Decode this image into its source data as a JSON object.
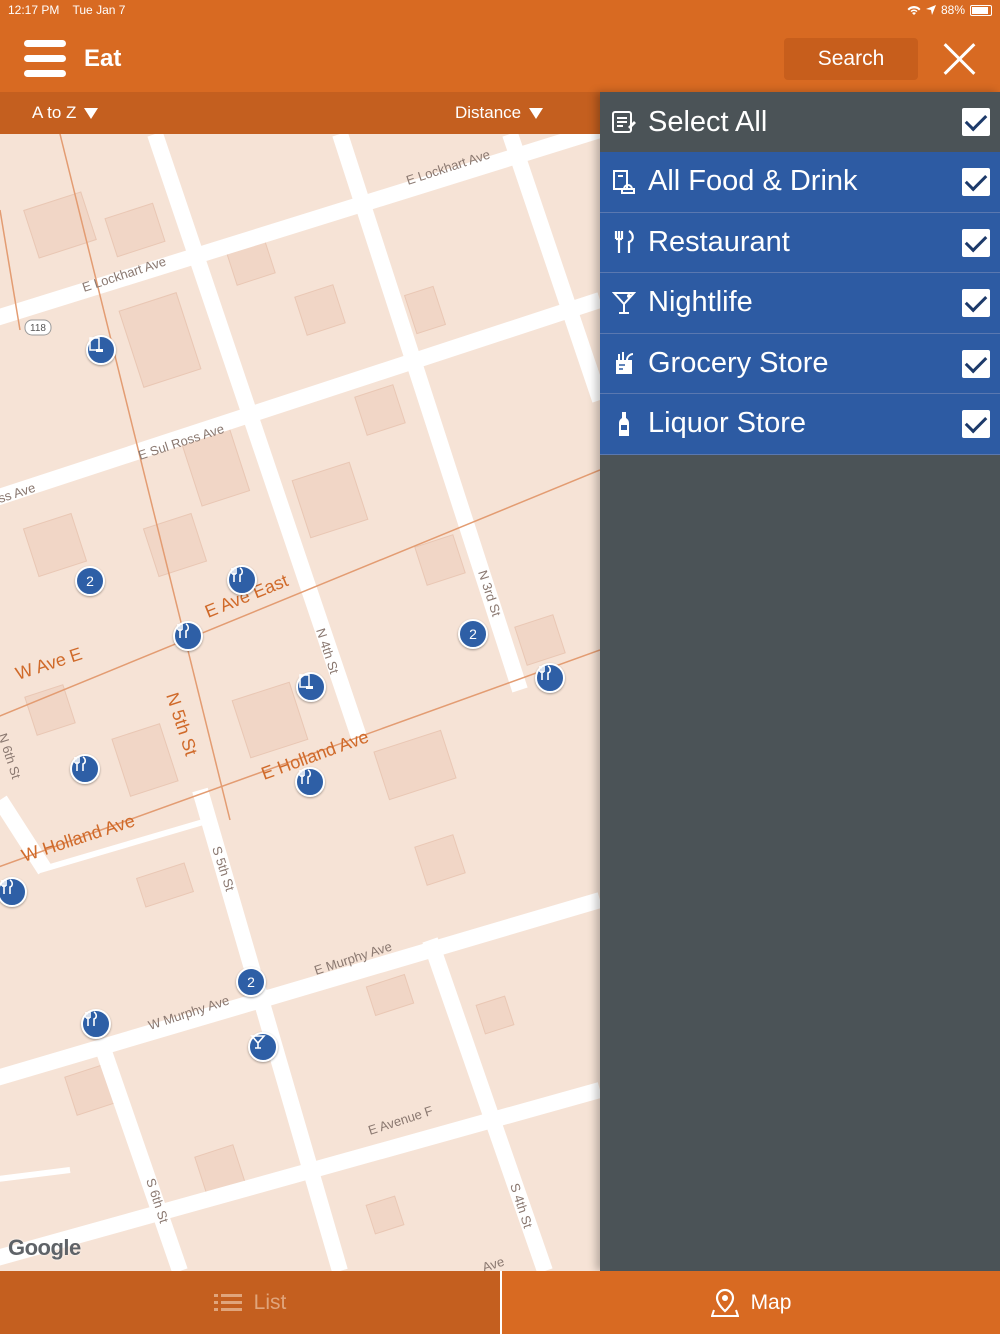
{
  "status": {
    "time": "12:17 PM",
    "date": "Tue Jan 7",
    "battery": "88%"
  },
  "header": {
    "title": "Eat",
    "search_label": "Search"
  },
  "sortbar": {
    "az_label": "A to Z",
    "distance_label": "Distance"
  },
  "map": {
    "streets": {
      "lockhart_1": "E Lockhart Ave",
      "lockhart_2": "E Lockhart Ave",
      "route": "118",
      "sul_ross": "E Sul Ross Ave",
      "ross": "ss Ave",
      "ave_e_east": "E Ave East",
      "w_ave_e": "W Ave E",
      "n5th": "N 5th St",
      "n4th": "N 4th St",
      "n3rd": "N 3rd St",
      "e_holland": "E Holland Ave",
      "w_holland": "W Holland Ave",
      "n6th": "N 6th St",
      "s5th": "S 5th St",
      "e_murphy": "E Murphy Ave",
      "w_murphy": "W Murphy Ave",
      "e_avenue_f": "E Avenue F",
      "s6th": "S 6th St",
      "s4th": "S 4th St",
      "ave_bottom": "Ave"
    },
    "cluster_count": "2",
    "attribution": "Google"
  },
  "filters": {
    "select_all": "Select All",
    "items": [
      {
        "label": "All Food & Drink",
        "icon": "food-drink-icon"
      },
      {
        "label": "Restaurant",
        "icon": "fork-knife-icon"
      },
      {
        "label": "Nightlife",
        "icon": "cocktail-icon"
      },
      {
        "label": "Grocery Store",
        "icon": "grocery-bag-icon"
      },
      {
        "label": "Liquor Store",
        "icon": "bottle-icon"
      }
    ]
  },
  "tabs": {
    "list_label": "List",
    "map_label": "Map"
  },
  "colors": {
    "brand": "#d86a22",
    "panel": "#4b5357",
    "filter_blue": "#2d5ba3",
    "pin_blue": "#2e5fa6"
  }
}
